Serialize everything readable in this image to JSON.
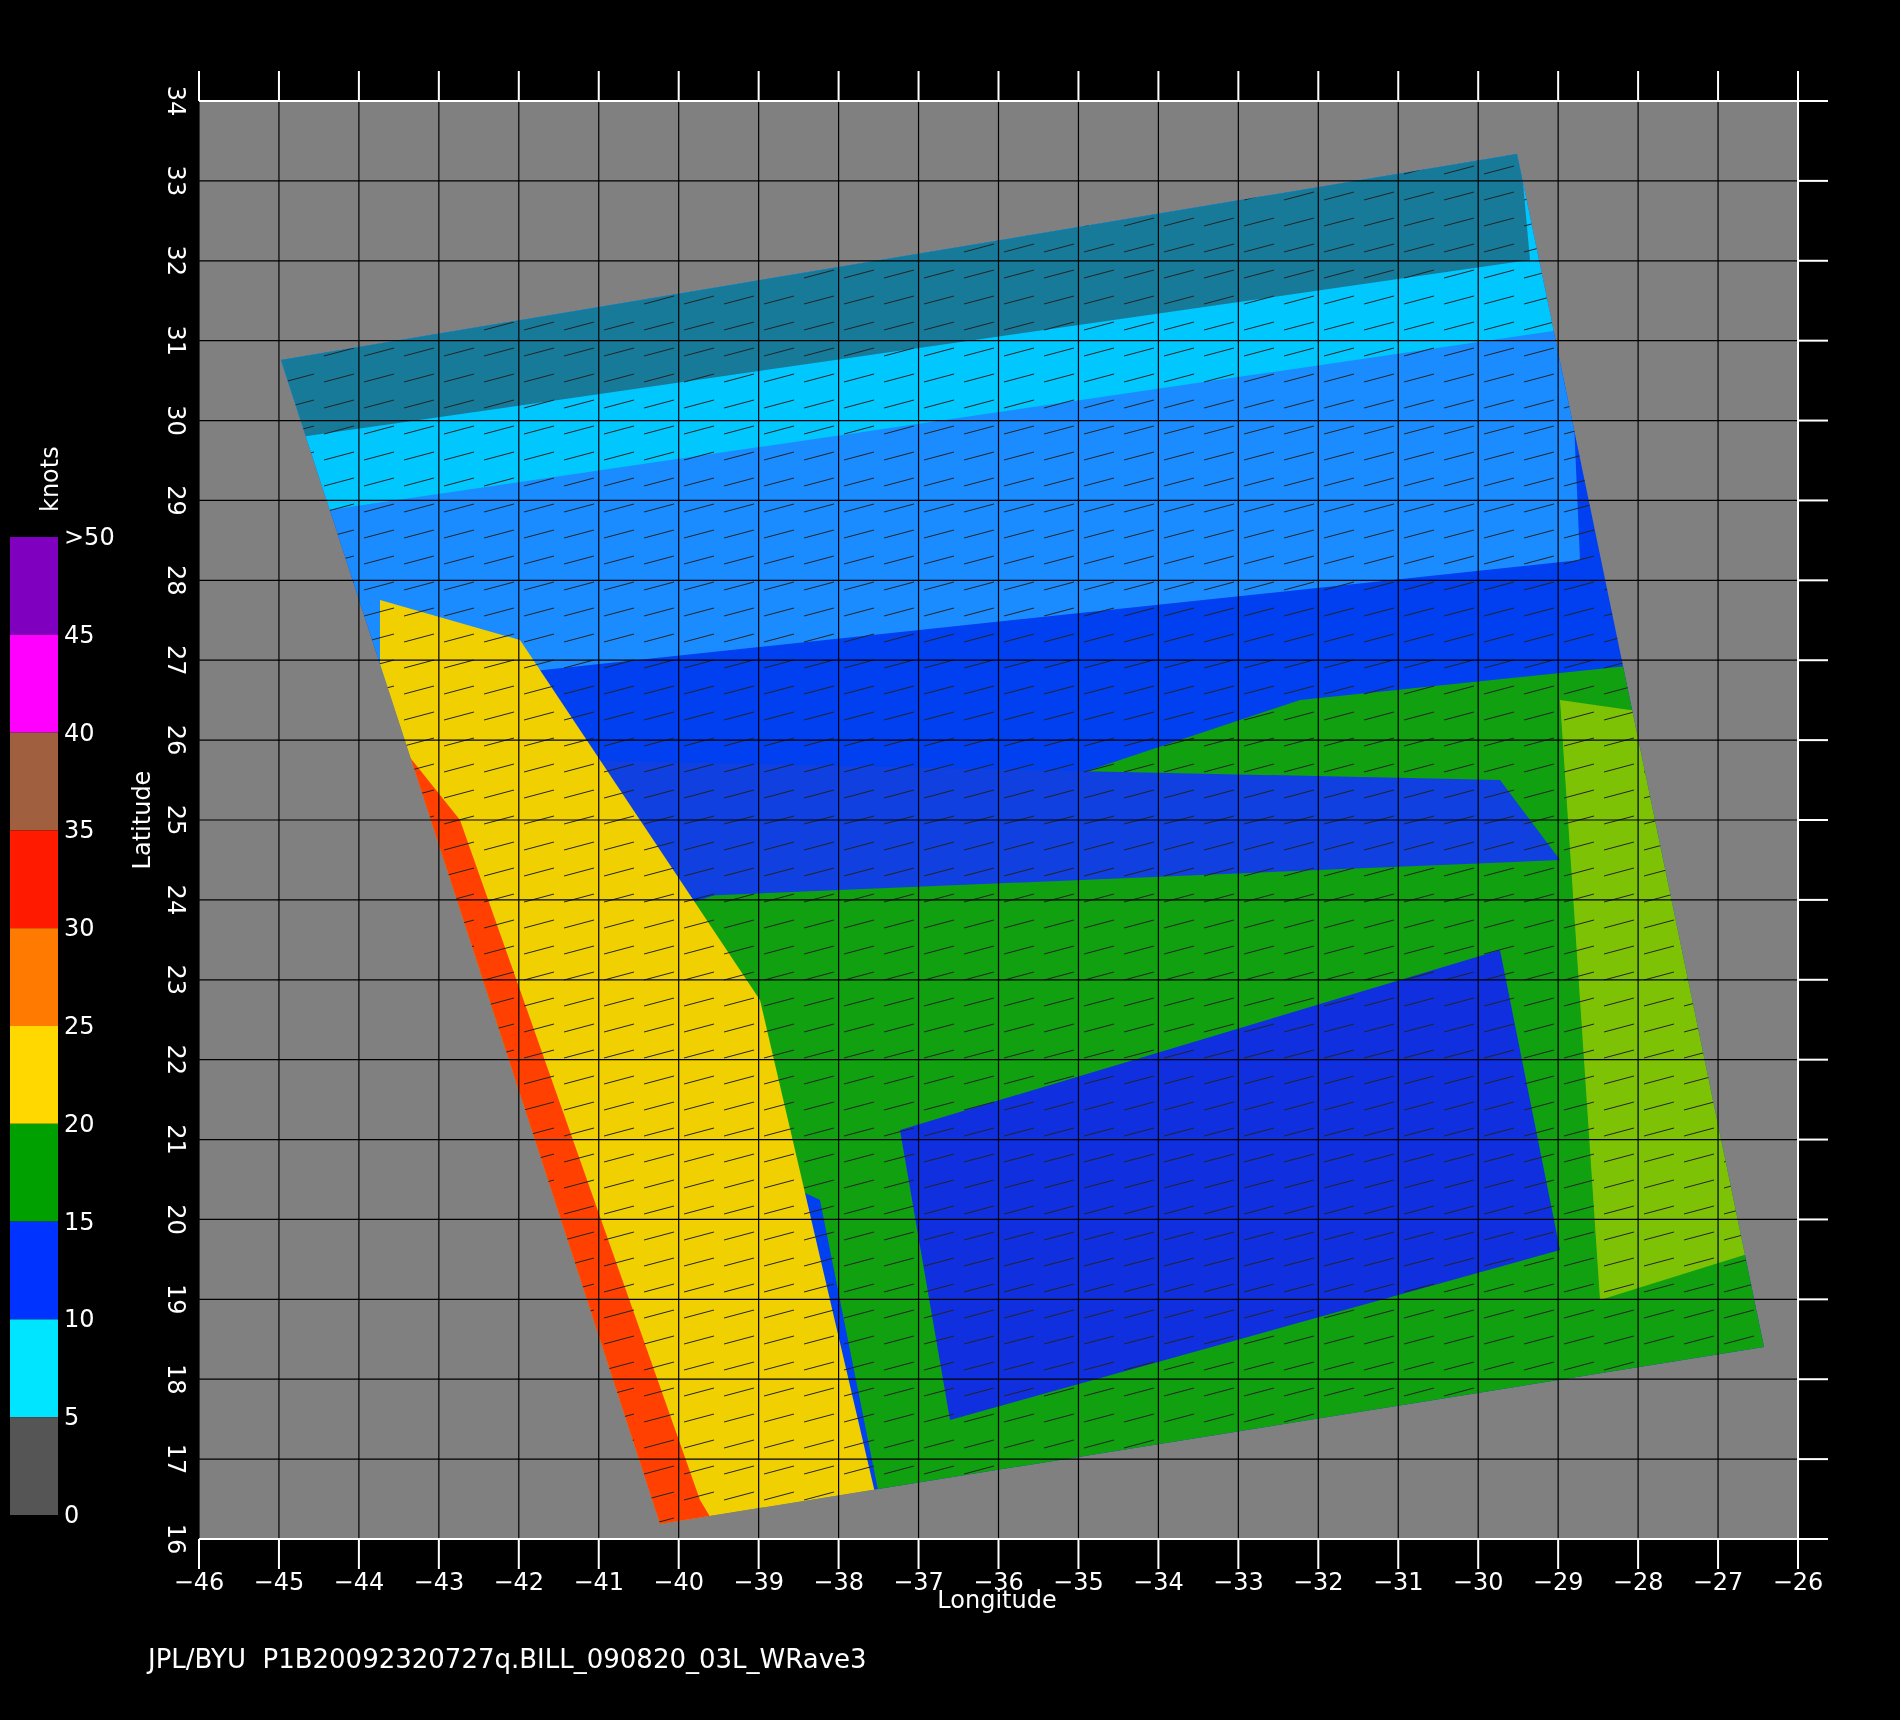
{
  "x_axis": {
    "title": "Longitude",
    "ticks": [
      "−46",
      "−45",
      "−44",
      "−43",
      "−42",
      "−41",
      "−40",
      "−39",
      "−38",
      "−37",
      "−36",
      "−35",
      "−34",
      "−33",
      "−32",
      "−31",
      "−30",
      "−29",
      "−28",
      "−27",
      "−26"
    ]
  },
  "y_axis": {
    "title": "Latitude",
    "ticks": [
      "16",
      "17",
      "18",
      "19",
      "20",
      "21",
      "22",
      "23",
      "24",
      "25",
      "26",
      "27",
      "28",
      "29",
      "30",
      "31",
      "32",
      "33",
      "34"
    ]
  },
  "colorbar": {
    "unit": "knots",
    "labels": [
      ">50",
      "45",
      "40",
      "35",
      "30",
      "25",
      "20",
      "15",
      "10",
      "5",
      "0"
    ],
    "segments": [
      {
        "color": "#8000c0"
      },
      {
        "color": "#ff00ff"
      },
      {
        "color": "#a06040"
      },
      {
        "color": "#ff1a00"
      },
      {
        "color": "#ff7a00"
      },
      {
        "color": "#ffd800"
      },
      {
        "color": "#00a000"
      },
      {
        "color": "#0033ff"
      },
      {
        "color": "#00e5ff"
      },
      {
        "color": "#555555"
      }
    ]
  },
  "caption": "JPL/BYU  P1B20092320727q.BILL_090820_03L_WRave3"
}
